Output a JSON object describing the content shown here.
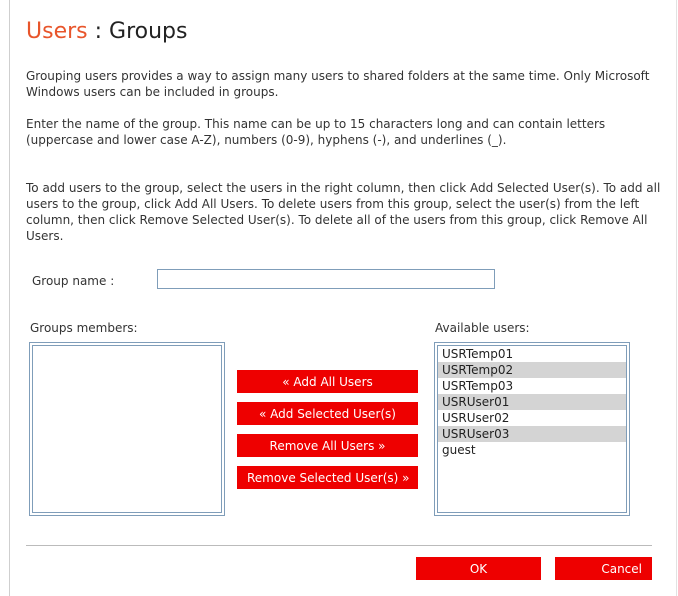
{
  "page": {
    "title_accent": "Users",
    "title_separator": ":",
    "title_rest": "Groups"
  },
  "instructions": {
    "p1": "Grouping users provides a way to assign many users to shared folders at the same time. Only Microsoft Windows users can be included in groups.",
    "p2": "Enter the name of the group. This name can be up to 15 characters long and can contain letters (uppercase and lower case A-Z), numbers (0-9), hyphens (-), and underlines (_).",
    "p3": "To add users to the group, select the users in the right column, then click Add Selected User(s). To add all users to the group, click Add All Users. To delete users from this group, select the user(s) from the left column, then click Remove Selected User(s). To delete all of the users from this group, click Remove All Users."
  },
  "form": {
    "group_name_label": "Group name   :",
    "group_name_value": ""
  },
  "members": {
    "label": "Groups members:",
    "items": []
  },
  "available": {
    "label": "Available users:",
    "items": [
      "USRTemp01",
      "USRTemp02",
      "USRTemp03",
      "USRUser01",
      "USRUser02",
      "USRUser03",
      "guest"
    ],
    "shaded": [
      false,
      true,
      false,
      true,
      false,
      true,
      false
    ]
  },
  "actions": {
    "add_all": "« Add All Users",
    "add_selected": "« Add Selected User(s)",
    "remove_all": "Remove All Users »",
    "remove_selected": "Remove Selected User(s) »"
  },
  "footer": {
    "ok": "OK",
    "cancel": "Cancel"
  },
  "colors": {
    "accent": "#e8552b",
    "button_red": "#ee0000",
    "list_shade": "#d4d4d4",
    "input_border": "#7f9db9"
  }
}
